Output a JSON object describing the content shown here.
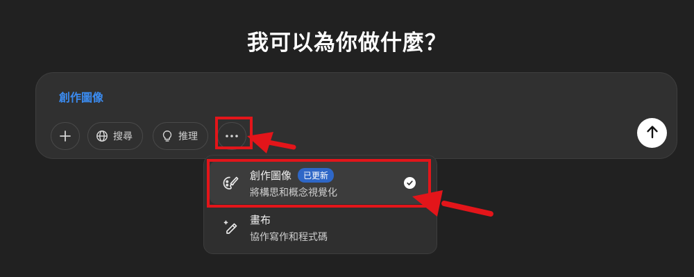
{
  "headline": "我可以為你做什麼？",
  "composer": {
    "input_text": "創作圖像",
    "tools": [
      {
        "icon": "plus-icon",
        "label": ""
      },
      {
        "icon": "globe-icon",
        "label": "搜尋"
      },
      {
        "icon": "lightbulb-icon",
        "label": "推理"
      },
      {
        "icon": "more-icon",
        "label": ""
      }
    ],
    "send_icon": "arrow-up-icon"
  },
  "menu": {
    "items": [
      {
        "icon": "palette-icon",
        "title": "創作圖像",
        "badge": "已更新",
        "description": "將構思和概念視覺化",
        "selected": true
      },
      {
        "icon": "pencil-sparkle-icon",
        "title": "畫布",
        "badge": "",
        "description": "協作寫作和程式碼",
        "selected": false
      }
    ]
  },
  "colors": {
    "background": "#212121",
    "composer": "#303030",
    "accent": "#3b8bf0",
    "badge": "#2e67c7",
    "annotation": "#e3151a"
  }
}
